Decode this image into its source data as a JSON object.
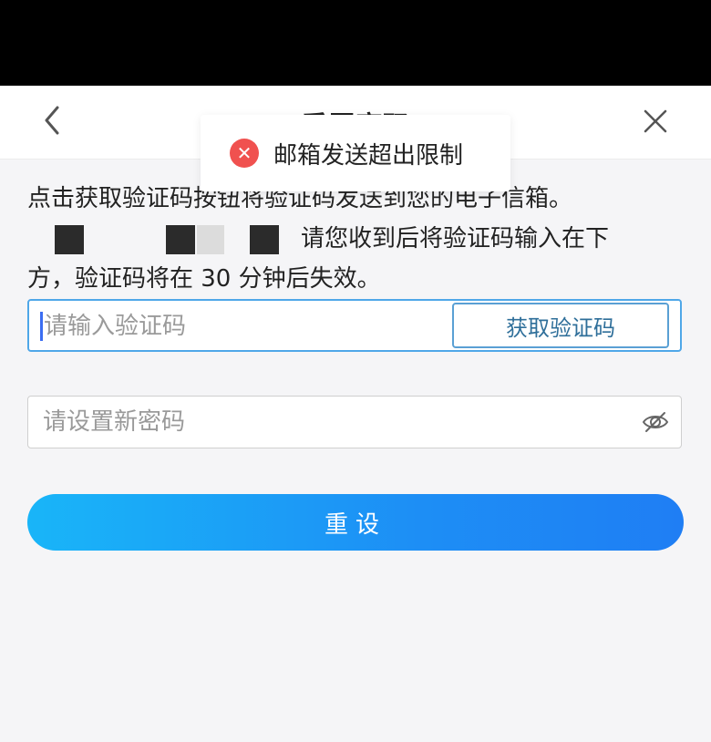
{
  "header": {
    "title": "重置密码",
    "back_icon": "chevron-left-icon",
    "close_icon": "close-icon"
  },
  "instructions": {
    "line1": "点击获取验证码按钮将验证码发送到您的电子信箱。",
    "line2_after_email": "请您收到后将验证码输入在下",
    "line3": "方，验证码将在 30 分钟后失效。"
  },
  "code_field": {
    "placeholder": "请输入验证码",
    "value": "",
    "get_code_label": "获取验证码"
  },
  "password_field": {
    "placeholder": "请设置新密码",
    "value": "",
    "visibility_icon": "eye-off-icon"
  },
  "reset_button": {
    "label": "重设"
  },
  "toast": {
    "icon": "error-icon",
    "message": "邮箱发送超出限制",
    "icon_color": "#f0514f"
  },
  "colors": {
    "accent_start": "#19b5f8",
    "accent_end": "#1f7ef4",
    "focus_border": "#4fa7e8"
  }
}
